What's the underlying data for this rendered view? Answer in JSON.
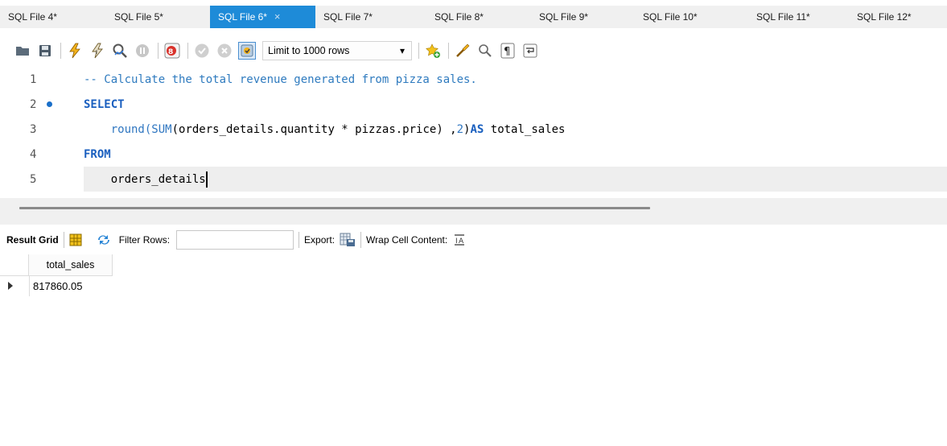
{
  "tabs": [
    {
      "label": "SQL File 4*",
      "active": false
    },
    {
      "label": "SQL File 5*",
      "active": false
    },
    {
      "label": "SQL File 6*",
      "active": true
    },
    {
      "label": "SQL File 7*",
      "active": false
    },
    {
      "label": "SQL File 8*",
      "active": false
    },
    {
      "label": "SQL File 9*",
      "active": false
    },
    {
      "label": "SQL File 10*",
      "active": false
    },
    {
      "label": "SQL File 11*",
      "active": false
    },
    {
      "label": "SQL File 12*",
      "active": false
    }
  ],
  "tab_close_glyph": "×",
  "toolbar": {
    "limit_label": "Limit to 1000 rows",
    "limit_dropdown_glyph": "▾"
  },
  "editor": {
    "lines": [
      {
        "num": "1",
        "text": "-- Calculate the total revenue generated from pizza sales."
      },
      {
        "num": "2",
        "text": "SELECT"
      },
      {
        "num": "3",
        "text": "    round(SUM(orders_details.quantity * pizzas.price) ,2)AS total_sales"
      },
      {
        "num": "4",
        "text": "FROM"
      },
      {
        "num": "5",
        "text": "    orders_details"
      }
    ],
    "tokens": {
      "l3_indent": "    ",
      "l3_round": "round(",
      "l3_sum": "SUM",
      "l3_mid": "(orders_details.quantity * pizzas.price) ,",
      "l3_two": "2",
      "l3_close": ")",
      "l3_as": "AS",
      "l3_tail": " total_sales",
      "l5_text": "    orders_details"
    }
  },
  "result_toolbar": {
    "result_grid_label": "Result Grid",
    "filter_rows_label": "Filter Rows:",
    "filter_value": "",
    "export_label": "Export:",
    "wrap_label": "Wrap Cell Content:"
  },
  "grid": {
    "columns": [
      "total_sales"
    ],
    "rows": [
      [
        "817860.05"
      ]
    ]
  },
  "colors": {
    "active_tab": "#1e8bd8",
    "comment": "#2f7bbf",
    "keyword": "#1a5fbf"
  }
}
